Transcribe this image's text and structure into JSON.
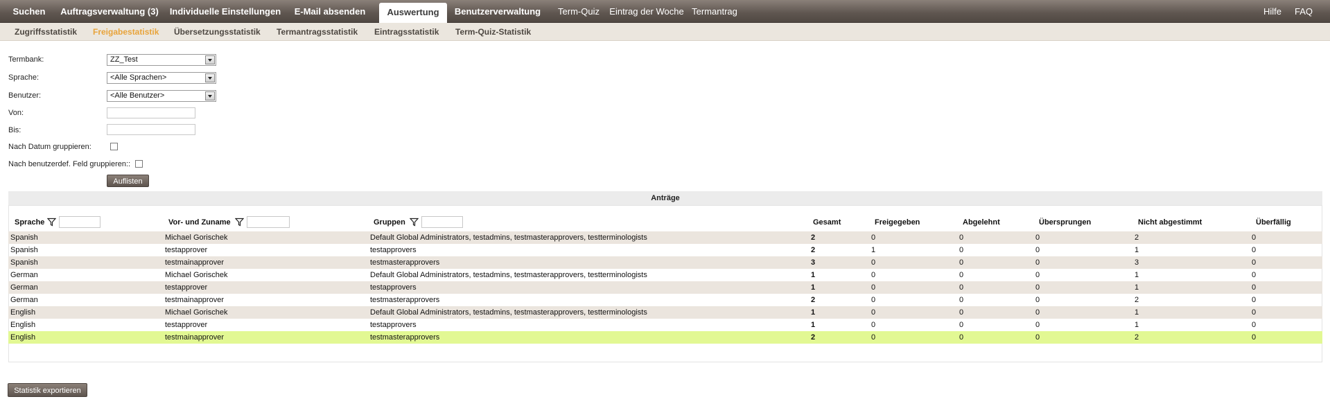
{
  "topnav": {
    "items": [
      "Suchen",
      "Auftragsverwaltung (3)",
      "Individuelle Einstellungen",
      "E-Mail absenden",
      "Auswertung",
      "Benutzerverwaltung",
      "Term-Quiz",
      "Eintrag der Woche",
      "Termantrag"
    ],
    "right": [
      "Hilfe",
      "FAQ"
    ],
    "active_index": 4
  },
  "subnav": {
    "items": [
      "Zugriffsstatistik",
      "Freigabestatistik",
      "Übersetzungsstatistik",
      "Termantragsstatistik",
      "Eintragsstatistik",
      "Term-Quiz-Statistik"
    ],
    "active_index": 1
  },
  "form": {
    "termbank_label": "Termbank:",
    "termbank_value": "ZZ_Test",
    "sprache_label": "Sprache:",
    "sprache_value": "<Alle Sprachen>",
    "benutzer_label": "Benutzer:",
    "benutzer_value": "<Alle Benutzer>",
    "von_label": "Von:",
    "von_value": "",
    "bis_label": "Bis:",
    "bis_value": "",
    "group_date_label": "Nach Datum gruppieren:",
    "group_custom_label": "Nach benutzerdef. Feld gruppieren::",
    "list_button": "Auflisten"
  },
  "results": {
    "title": "Anträge",
    "columns": [
      "Sprache",
      "Vor- und Zuname",
      "Gruppen",
      "Gesamt",
      "Freigegeben",
      "Abgelehnt",
      "Übersprungen",
      "Nicht abgestimmt",
      "Überfällig"
    ],
    "rows": [
      [
        "Spanish",
        "Michael Gorischek",
        "Default Global Administrators, testadmins, testmasterapprovers, testterminologists",
        "2",
        "0",
        "0",
        "0",
        "2",
        "0"
      ],
      [
        "Spanish",
        "testapprover",
        "testapprovers",
        "2",
        "1",
        "0",
        "0",
        "1",
        "0"
      ],
      [
        "Spanish",
        "testmainapprover",
        "testmasterapprovers",
        "3",
        "0",
        "0",
        "0",
        "3",
        "0"
      ],
      [
        "German",
        "Michael Gorischek",
        "Default Global Administrators, testadmins, testmasterapprovers, testterminologists",
        "1",
        "0",
        "0",
        "0",
        "1",
        "0"
      ],
      [
        "German",
        "testapprover",
        "testapprovers",
        "1",
        "0",
        "0",
        "0",
        "1",
        "0"
      ],
      [
        "German",
        "testmainapprover",
        "testmasterapprovers",
        "2",
        "0",
        "0",
        "0",
        "2",
        "0"
      ],
      [
        "English",
        "Michael Gorischek",
        "Default Global Administrators, testadmins, testmasterapprovers, testterminologists",
        "1",
        "0",
        "0",
        "0",
        "1",
        "0"
      ],
      [
        "English",
        "testapprover",
        "testapprovers",
        "1",
        "0",
        "0",
        "0",
        "1",
        "0"
      ],
      [
        "English",
        "testmainapprover",
        "testmasterapprovers",
        "2",
        "0",
        "0",
        "0",
        "2",
        "0"
      ]
    ],
    "selected_row": 8
  },
  "export_button": "Statistik exportieren",
  "icons": {
    "filter": "filter-funnel-icon",
    "dropdown": "chevron-down-icon"
  },
  "colors": {
    "nav_bg": "#5e554f",
    "subnav_bg": "#ebe6de",
    "active_sub": "#e8a33a",
    "row_alt": "#ebe5de",
    "row_selected": "#e2f893"
  }
}
